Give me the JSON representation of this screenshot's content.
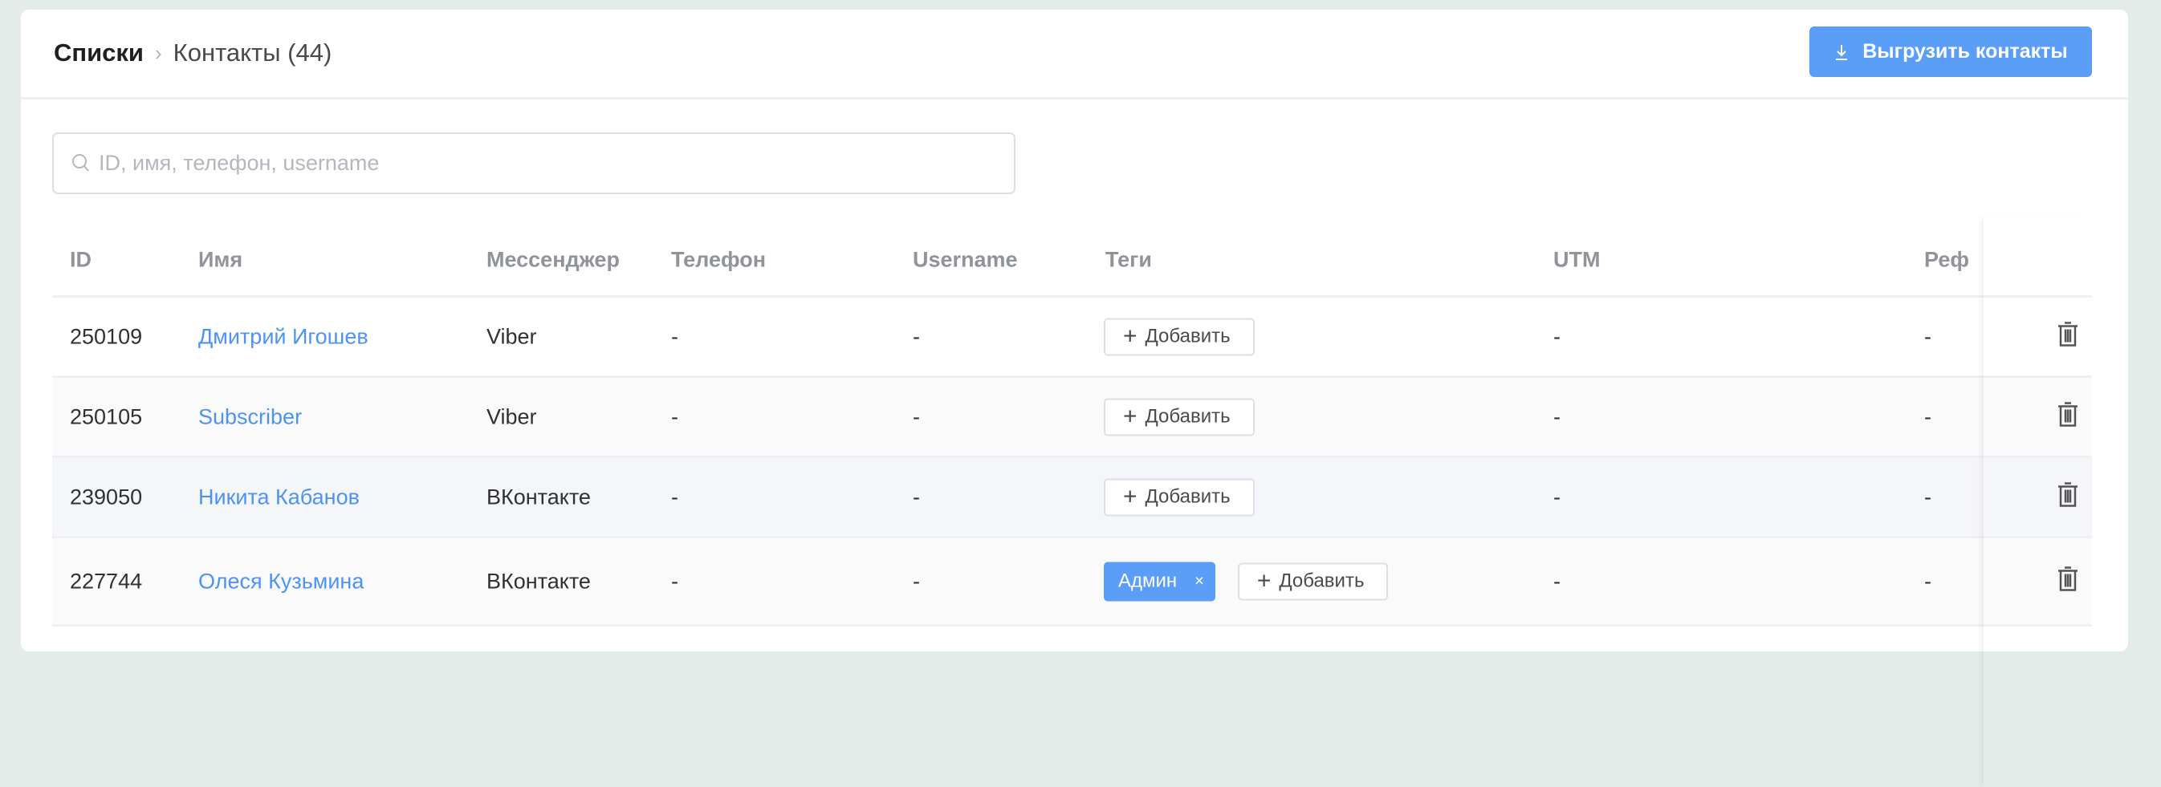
{
  "breadcrumb": {
    "root": "Списки",
    "current": "Контакты (44)"
  },
  "export_button": {
    "label": "Выгрузить контакты",
    "icon": "download-icon"
  },
  "search": {
    "placeholder": "ID, имя, телефон, username",
    "value": ""
  },
  "colors": {
    "accent": "#5b9ef8",
    "link": "#4c93f2"
  },
  "table": {
    "columns": [
      "ID",
      "Имя",
      "Мессенджер",
      "Телефон",
      "Username",
      "Теги",
      "UTM",
      "Реф"
    ],
    "add_tag_label": "Добавить",
    "rows": [
      {
        "id": "250109",
        "name": "Дмитрий Игошев",
        "messenger": "Viber",
        "phone": "-",
        "username": "-",
        "tags": [],
        "utm": "-",
        "ref": "-"
      },
      {
        "id": "250105",
        "name": "Subscriber",
        "messenger": "Viber",
        "phone": "-",
        "username": "-",
        "tags": [],
        "utm": "-",
        "ref": "-"
      },
      {
        "id": "239050",
        "name": "Никита Кабанов",
        "messenger": "ВКонтакте",
        "phone": "-",
        "username": "-",
        "tags": [],
        "utm": "-",
        "ref": "-"
      },
      {
        "id": "227744",
        "name": "Олеся Кузьмина",
        "messenger": "ВКонтакте",
        "phone": "-",
        "username": "-",
        "tags": [
          "Админ"
        ],
        "utm": "-",
        "ref": "-"
      }
    ]
  }
}
